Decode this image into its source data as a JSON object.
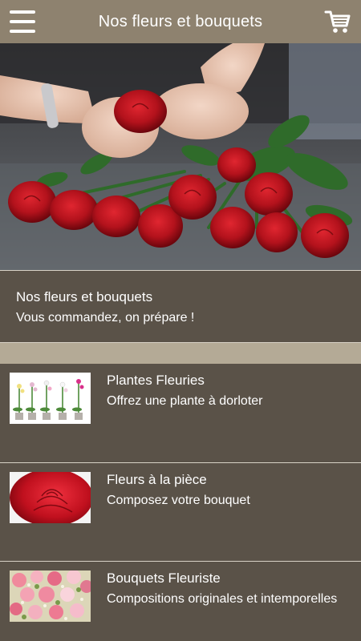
{
  "header": {
    "title": "Nos fleurs et bouquets",
    "menu_icon": "hamburger-menu-icon",
    "cart_icon": "shopping-cart-icon",
    "bar_color": "#8e826f"
  },
  "intro": {
    "title": "Nos fleurs et bouquets",
    "subtitle": "Vous commandez, on prépare !"
  },
  "categories": [
    {
      "title": "Plantes Fleuries",
      "subtitle": "Offrez une plante à dorloter"
    },
    {
      "title": "Fleurs à la pièce",
      "subtitle": "Composez votre bouquet"
    },
    {
      "title": "Bouquets Fleuriste",
      "subtitle": "Compositions originales et intemporelles"
    }
  ],
  "colors": {
    "background": "#5a5248",
    "band": "#b4aa96",
    "rose": "#b3121c",
    "leaf": "#2f6b2a"
  }
}
